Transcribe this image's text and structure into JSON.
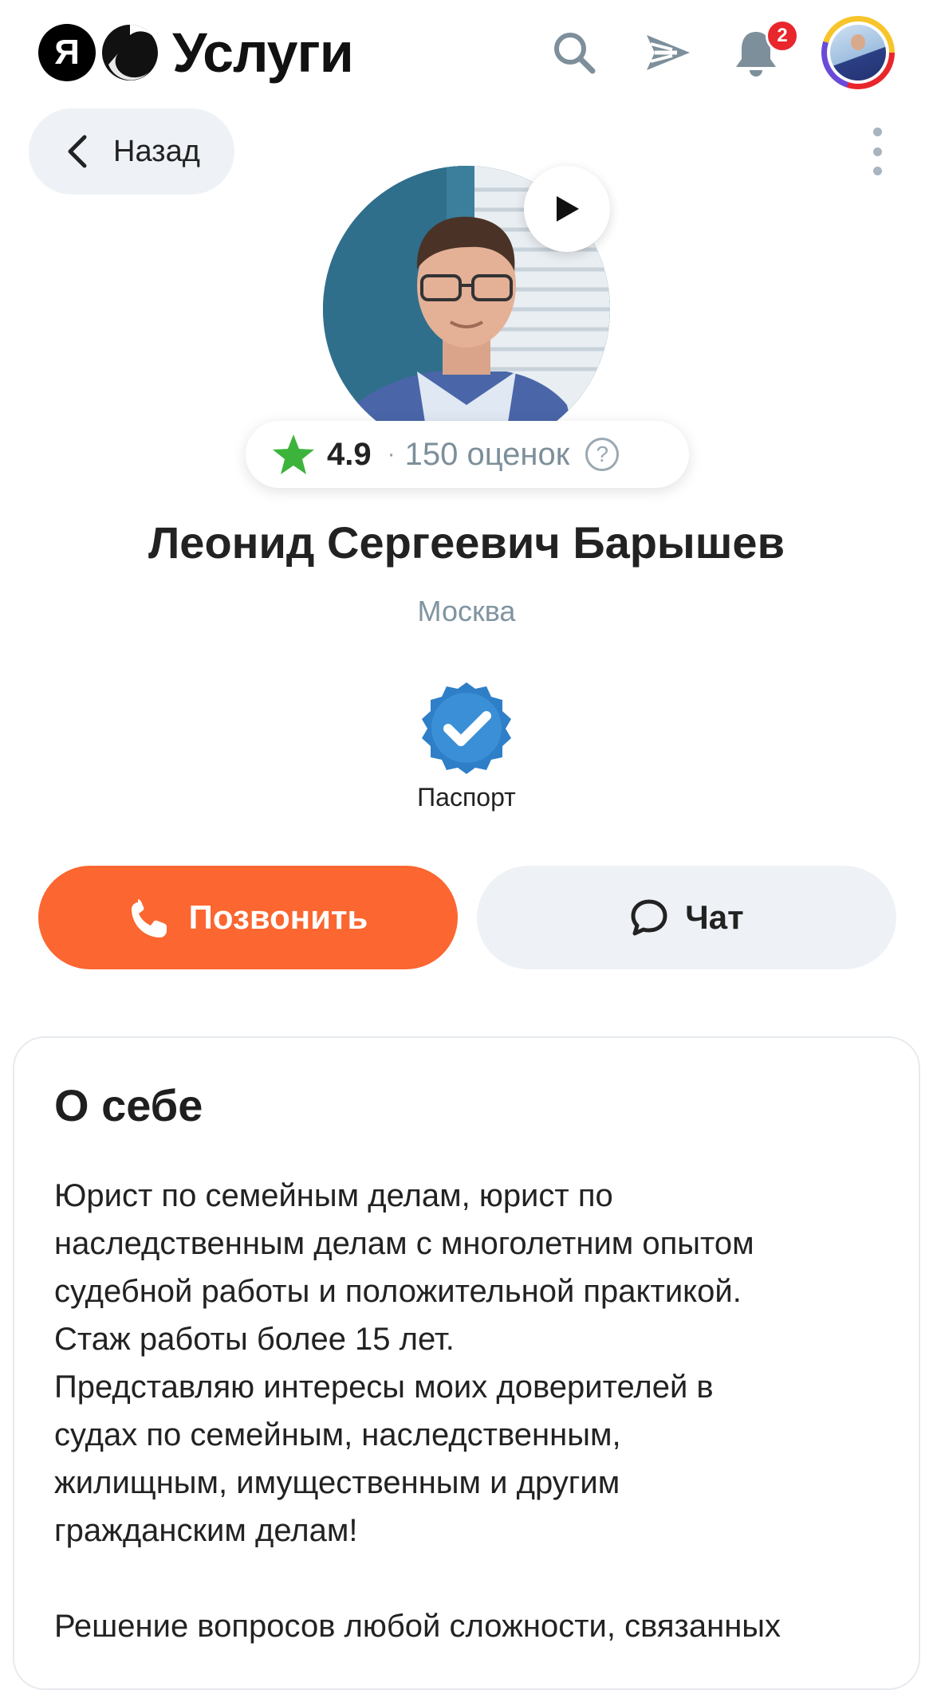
{
  "header": {
    "logo_letter": "Я",
    "logo_text": "Услуги",
    "notification_count": "2",
    "icons": [
      "search-icon",
      "send-icon",
      "bell-icon",
      "avatar"
    ]
  },
  "nav": {
    "back_label": "Назад",
    "more_icon": "more-vertical-icon"
  },
  "profile": {
    "rating": "4.9",
    "rating_separator": "·",
    "reviews_count": "150 оценок",
    "help_symbol": "?",
    "name": "Леонид Сергеевич Барышев",
    "city": "Москва",
    "verification_label": "Паспорт"
  },
  "actions": {
    "call_label": "Позвонить",
    "chat_label": "Чат"
  },
  "about": {
    "title": "О себе",
    "text": "Юрист по семейным делам, юрист по\nнаследственным делам с многолетним опытом\nсудебной работы и положительной практикой.\nСтаж работы более 15 лет.\nПредставляю интересы моих доверителей в\nсудах по семейным, наследственным,\nжилищным, имущественным и другим\nгражданским делам!\n\nРешение вопросов любой сложности, связанных"
  },
  "colors": {
    "accent": "#fc6630",
    "star": "#3cb43c",
    "badge": "#e8262b",
    "secondary_button": "#eef2f6"
  }
}
